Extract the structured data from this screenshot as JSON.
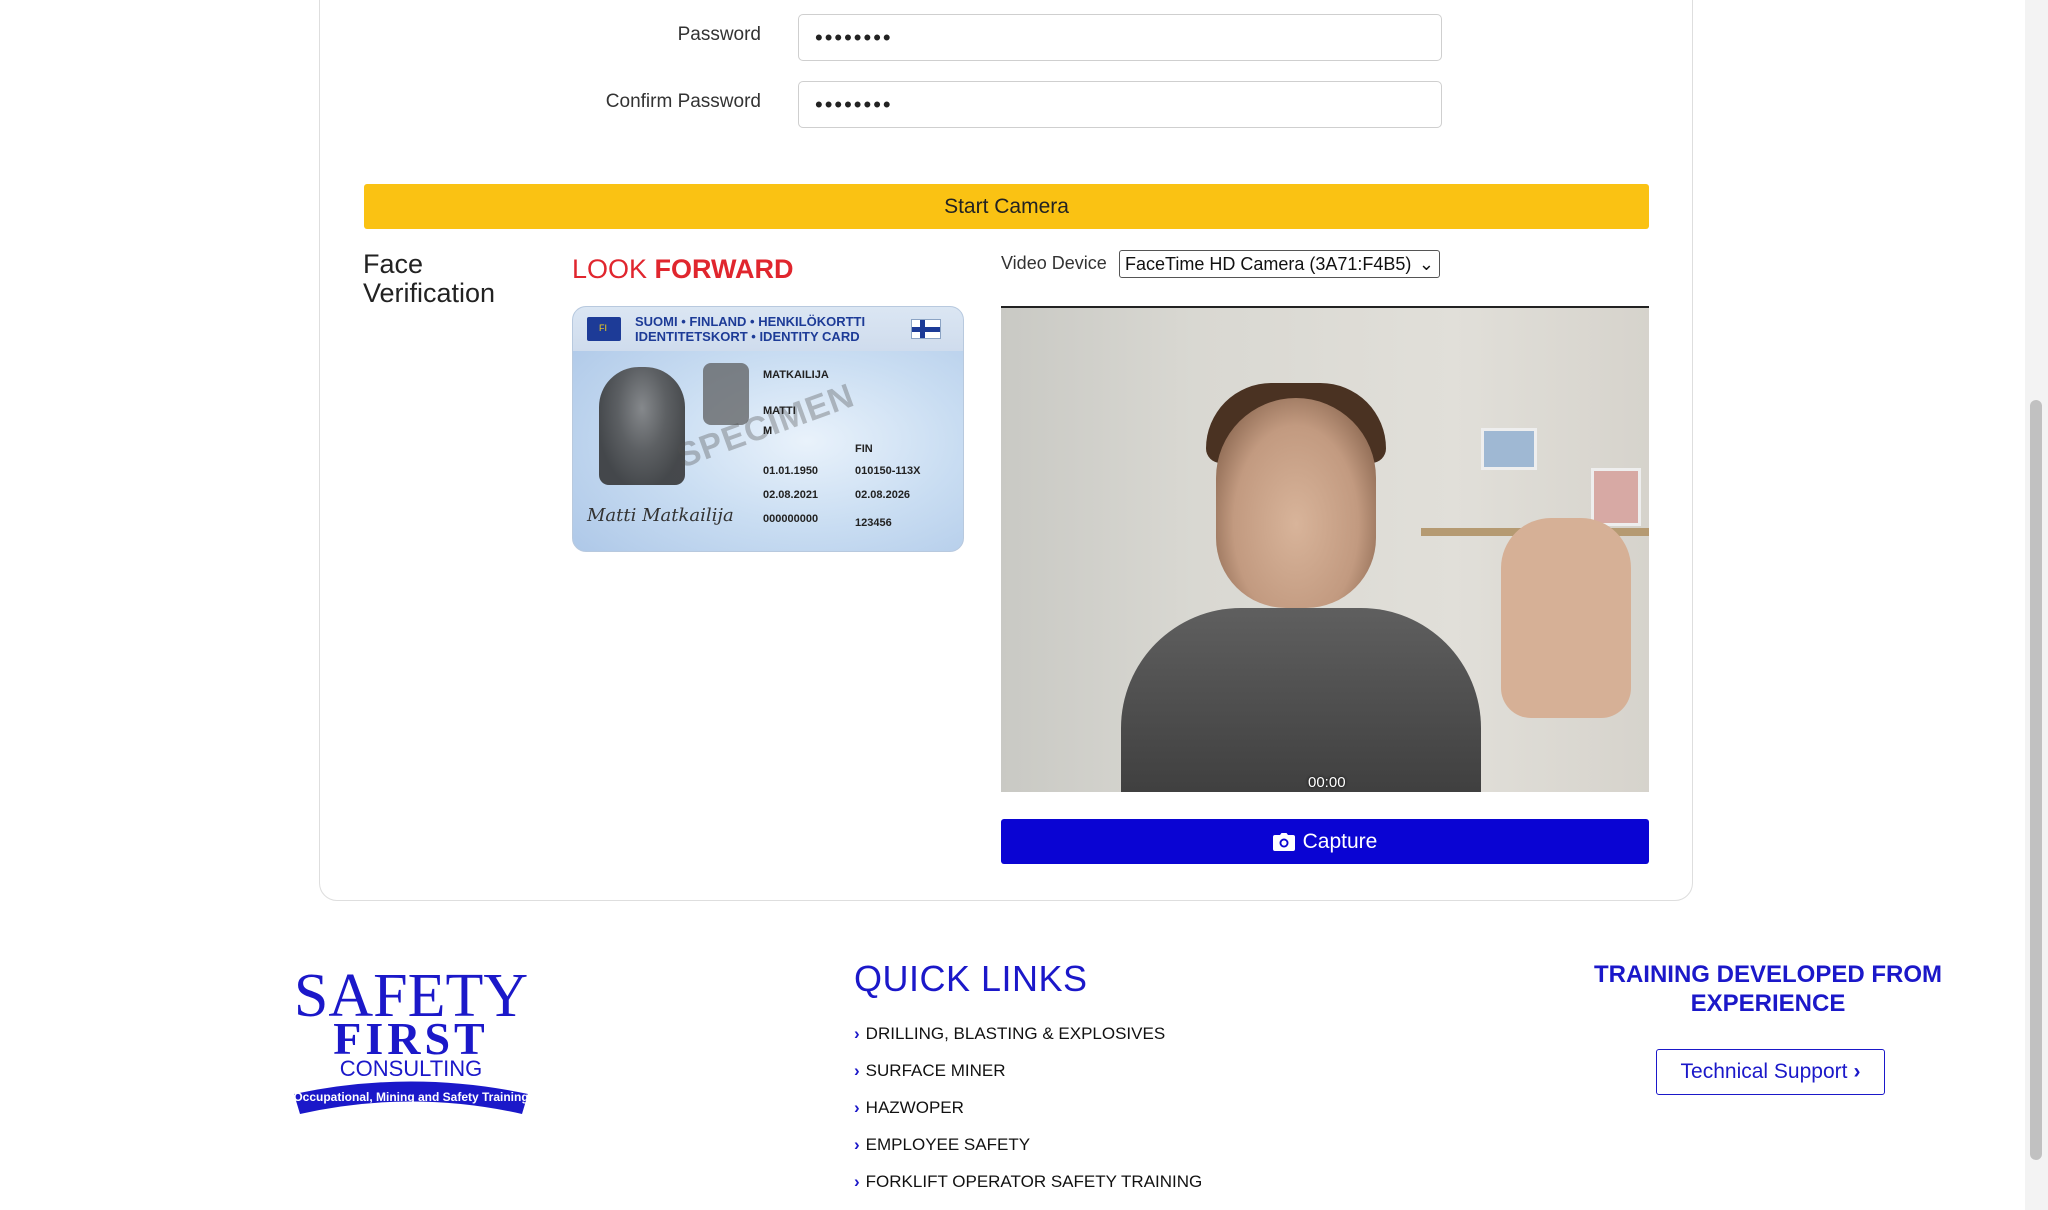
{
  "form": {
    "password_label": "Password",
    "password_value": "••••••••",
    "confirm_label": "Confirm Password",
    "confirm_value": "••••••••",
    "start_camera_label": "Start Camera"
  },
  "face": {
    "title_line1": "Face",
    "title_line2": "Verification",
    "look_prefix": "LOOK",
    "look_emphasis": "FORWARD",
    "accent_color": "#e0262e"
  },
  "id_card": {
    "header_line1": "SUOMI • FINLAND • HENKILÖKORTTI",
    "header_line2": "IDENTITETSKORT • IDENTITY CARD",
    "eu_code": "FI",
    "surname": "MATKAILIJA",
    "given_name": "MATTI",
    "sex": "M",
    "nationality": "FIN",
    "birth_date": "01.01.1950",
    "personal_code": "010150-113X",
    "issue_date": "02.08.2021",
    "expiry_date": "02.08.2026",
    "number": "000000000",
    "can": "123456",
    "watermark": "SPECIMEN",
    "signature": "Matti Matkailija"
  },
  "video": {
    "device_label": "Video Device",
    "device_selected": "FaceTime HD Camera (3A71:F4B5)",
    "timestamp": "00:00",
    "capture_label": "Capture"
  },
  "footer": {
    "logo_line1": "SAFETY",
    "logo_line2": "FIRST",
    "logo_line3": "CONSULTING",
    "logo_banner": "Occupational, Mining and Safety Training",
    "quick_links_title": "QUICK LINKS",
    "quick_links": [
      "DRILLING, BLASTING & EXPLOSIVES",
      "SURFACE MINER",
      "HAZWOPER",
      "EMPLOYEE SAFETY",
      "FORKLIFT OPERATOR SAFETY TRAINING"
    ],
    "training_line1": "TRAINING DEVELOPED FROM",
    "training_line2": "EXPERIENCE",
    "tech_support_label": "Technical Support"
  },
  "colors": {
    "primary_blue": "#0a04d3",
    "link_blue": "#1b18c9",
    "yellow": "#fac213",
    "red": "#e0262e"
  }
}
